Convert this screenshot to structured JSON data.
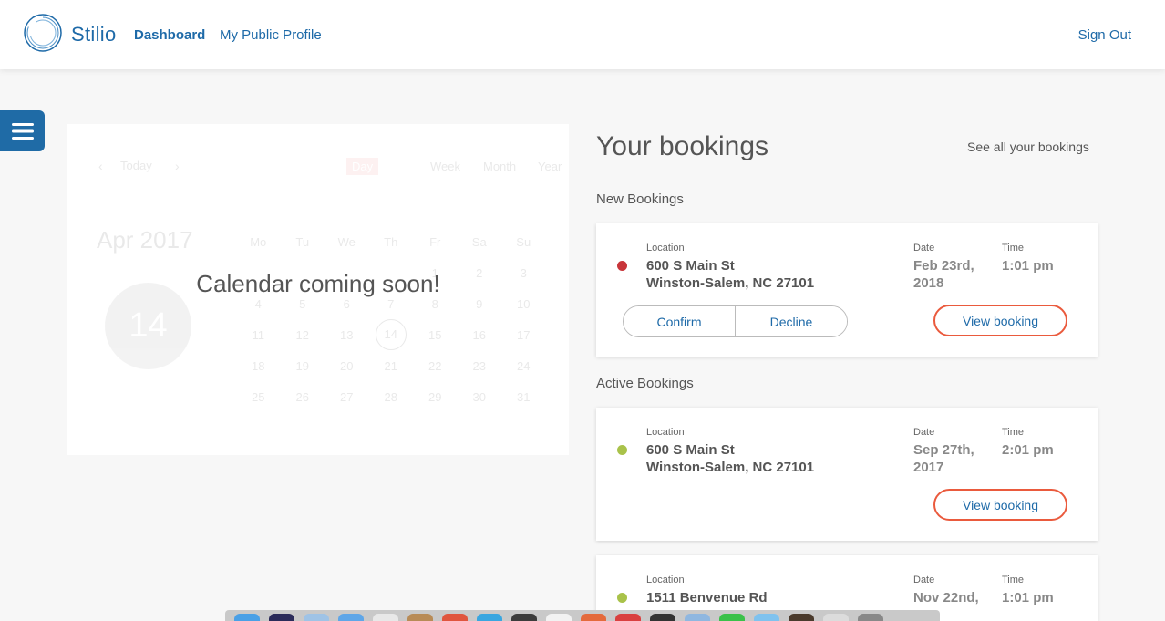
{
  "header": {
    "brand": "Stilio",
    "nav": {
      "dashboard": "Dashboard",
      "public_profile": "My Public Profile"
    },
    "sign_out": "Sign Out"
  },
  "calendar": {
    "toolbar": {
      "today": "Today",
      "views": [
        "Day",
        "Week",
        "Month",
        "Year"
      ],
      "active_view": "Day"
    },
    "month_label": "Apr 2017",
    "selected_day": "14",
    "weekdays": [
      "Mo",
      "Tu",
      "We",
      "Th",
      "Fr",
      "Sa",
      "Su"
    ],
    "weeks": [
      [
        "",
        "",
        "",
        "",
        "1",
        "2",
        "3"
      ],
      [
        "4",
        "5",
        "6",
        "7",
        "8",
        "9",
        "10"
      ],
      [
        "11",
        "12",
        "13",
        "14",
        "15",
        "16",
        "17"
      ],
      [
        "18",
        "19",
        "20",
        "21",
        "22",
        "23",
        "24"
      ],
      [
        "25",
        "26",
        "27",
        "28",
        "29",
        "30",
        "31"
      ]
    ],
    "overlay": "Calendar coming soon!"
  },
  "bookings": {
    "title": "Your bookings",
    "see_all": "See all your bookings",
    "labels": {
      "location": "Location",
      "date": "Date",
      "time": "Time"
    },
    "new_section": "New Bookings",
    "active_section": "Active Bookings",
    "new": [
      {
        "status_color": "#c8353a",
        "address_line1": "600 S Main St",
        "address_line2": "Winston-Salem, NC 27101",
        "date_line1": "Feb 23rd,",
        "date_line2": "2018",
        "time": "1:01 pm",
        "confirm": "Confirm",
        "decline": "Decline",
        "view": "View booking"
      }
    ],
    "active": [
      {
        "status_color": "#a9c24a",
        "address_line1": "600 S Main St",
        "address_line2": "Winston-Salem, NC 27101",
        "date_line1": "Sep 27th,",
        "date_line2": "2017",
        "time": "2:01 pm",
        "view": "View booking"
      },
      {
        "status_color": "#a9c24a",
        "address_line1": "1511 Benvenue Rd",
        "date_line1": "Nov 22nd,",
        "time": "1:01 pm"
      }
    ]
  },
  "colors": {
    "brand": "#1e6aa8",
    "accent": "#ea5a3d",
    "new_status": "#c8353a",
    "active_status": "#a9c24a"
  }
}
